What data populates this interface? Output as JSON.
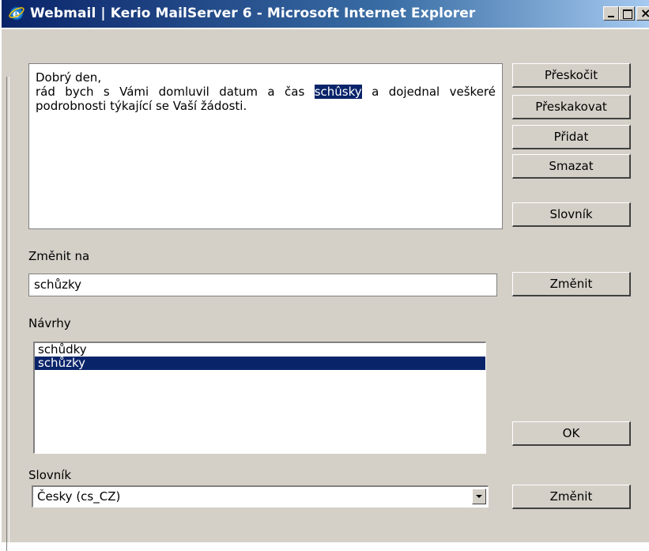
{
  "window": {
    "title": "Webmail | Kerio MailServer 6 - Microsoft Internet Explorer"
  },
  "text_content": {
    "line1": "Dobrý den,",
    "line2_before": "rád bych s Vámi domluvil datum a čas ",
    "highlighted_word": "schûsky",
    "line2_after": " a dojednal veškeré podrobnosti týkající se Vaší žádosti."
  },
  "buttons": {
    "skip": "Přeskočit",
    "skip_all": "Přeskakovat",
    "add": "Přidat",
    "delete": "Smazat",
    "dictionary": "Slovník",
    "change": "Změnit",
    "ok": "OK",
    "change_language": "Změnit"
  },
  "change_to": {
    "label": "Změnit na",
    "value": "schůzky"
  },
  "suggestions": {
    "label": "Návrhy",
    "items": [
      "schůdky",
      "schůzky"
    ],
    "selected_index": 1
  },
  "dictionary": {
    "label": "Slovník",
    "selected": "Česky (cs_CZ)"
  },
  "colors": {
    "selection": "#0a246a",
    "dialog_bg": "#d4d0c8"
  }
}
